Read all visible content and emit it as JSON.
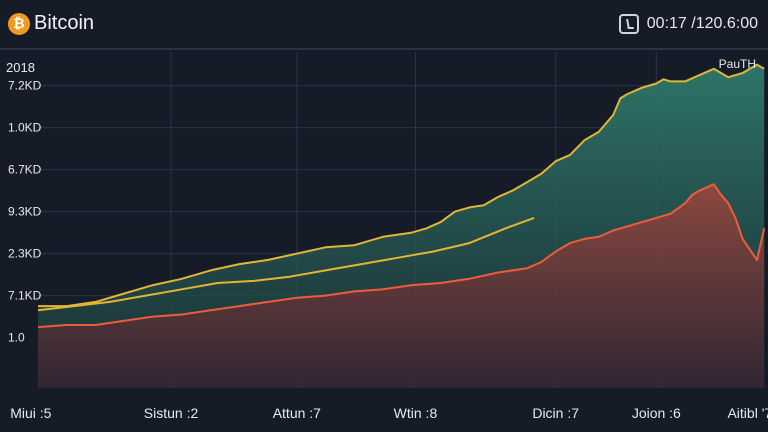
{
  "header": {
    "coin_symbol": "₿",
    "title": "Bitcoin",
    "timer": "00:17 /120.6:00"
  },
  "year_label": "2018",
  "legend_label": "PauTH",
  "colors": {
    "yellow": "#e3b535",
    "orange": "#ef5b3c",
    "teal": "#2f7a6c",
    "grid": "#2a3446"
  },
  "chart_data": {
    "type": "area",
    "ylim": [
      0,
      8
    ],
    "yticks": [
      {
        "label": "7.2KD",
        "v": 7.2
      },
      {
        "label": "1.0KD",
        "v": 6.2
      },
      {
        "label": "6.7KD",
        "v": 5.2
      },
      {
        "label": "9.3KD",
        "v": 4.2
      },
      {
        "label": "2.3KD",
        "v": 3.2
      },
      {
        "label": "7.1KD",
        "v": 2.2
      },
      {
        "label": "1.0",
        "v": 1.2
      }
    ],
    "x_range": [
      0,
      100
    ],
    "xticks": [
      {
        "label": "Miui :5",
        "x": -1
      },
      {
        "label": "Sistun :2",
        "x": 18.5
      },
      {
        "label": "Attun :7",
        "x": 36
      },
      {
        "label": "Wtin :8",
        "x": 52.5
      },
      {
        "label": "Dicin :7",
        "x": 72
      },
      {
        "label": "Joion :6",
        "x": 86
      },
      {
        "label": "Aitibl '7",
        "x": 99
      }
    ],
    "series": [
      {
        "color": "#e3b535",
        "x": [
          0,
          4,
          8,
          12,
          16,
          20,
          24,
          28,
          32,
          36,
          40,
          44,
          48,
          52,
          54,
          56,
          58,
          60,
          62,
          64,
          66,
          68,
          70,
          72,
          74,
          76,
          78,
          80,
          81,
          82,
          84,
          86,
          87,
          88,
          90,
          92,
          94,
          96,
          98,
          100,
          101
        ],
        "values": [
          1.95,
          1.95,
          2.05,
          2.25,
          2.45,
          2.6,
          2.8,
          2.95,
          3.05,
          3.2,
          3.35,
          3.4,
          3.6,
          3.7,
          3.8,
          3.95,
          4.2,
          4.3,
          4.35,
          4.55,
          4.7,
          4.9,
          5.1,
          5.4,
          5.55,
          5.9,
          6.1,
          6.5,
          6.9,
          7.0,
          7.15,
          7.25,
          7.35,
          7.3,
          7.3,
          7.45,
          7.6,
          7.4,
          7.5,
          7.7,
          7.6
        ]
      },
      {
        "color": "#e3b535",
        "x": [
          0,
          5,
          10,
          15,
          20,
          25,
          30,
          35,
          40,
          45,
          50,
          55,
          60,
          65,
          69
        ],
        "values": [
          1.85,
          1.95,
          2.05,
          2.2,
          2.35,
          2.5,
          2.55,
          2.65,
          2.8,
          2.95,
          3.1,
          3.25,
          3.45,
          3.8,
          4.05
        ]
      },
      {
        "color": "#ef5b3c",
        "x": [
          0,
          4,
          8,
          12,
          16,
          20,
          24,
          28,
          32,
          36,
          40,
          44,
          48,
          52,
          56,
          60,
          64,
          68,
          70,
          72,
          74,
          76,
          78,
          80,
          82,
          84,
          86,
          88,
          90,
          91,
          92,
          94,
          95,
          96,
          97,
          98,
          99,
          100,
          101
        ],
        "values": [
          1.45,
          1.5,
          1.5,
          1.6,
          1.7,
          1.75,
          1.85,
          1.95,
          2.05,
          2.15,
          2.2,
          2.3,
          2.35,
          2.45,
          2.5,
          2.6,
          2.75,
          2.85,
          3.0,
          3.25,
          3.45,
          3.55,
          3.6,
          3.75,
          3.85,
          3.95,
          4.05,
          4.15,
          4.4,
          4.6,
          4.7,
          4.85,
          4.6,
          4.4,
          4.05,
          3.55,
          3.3,
          3.05,
          3.8
        ]
      }
    ]
  }
}
